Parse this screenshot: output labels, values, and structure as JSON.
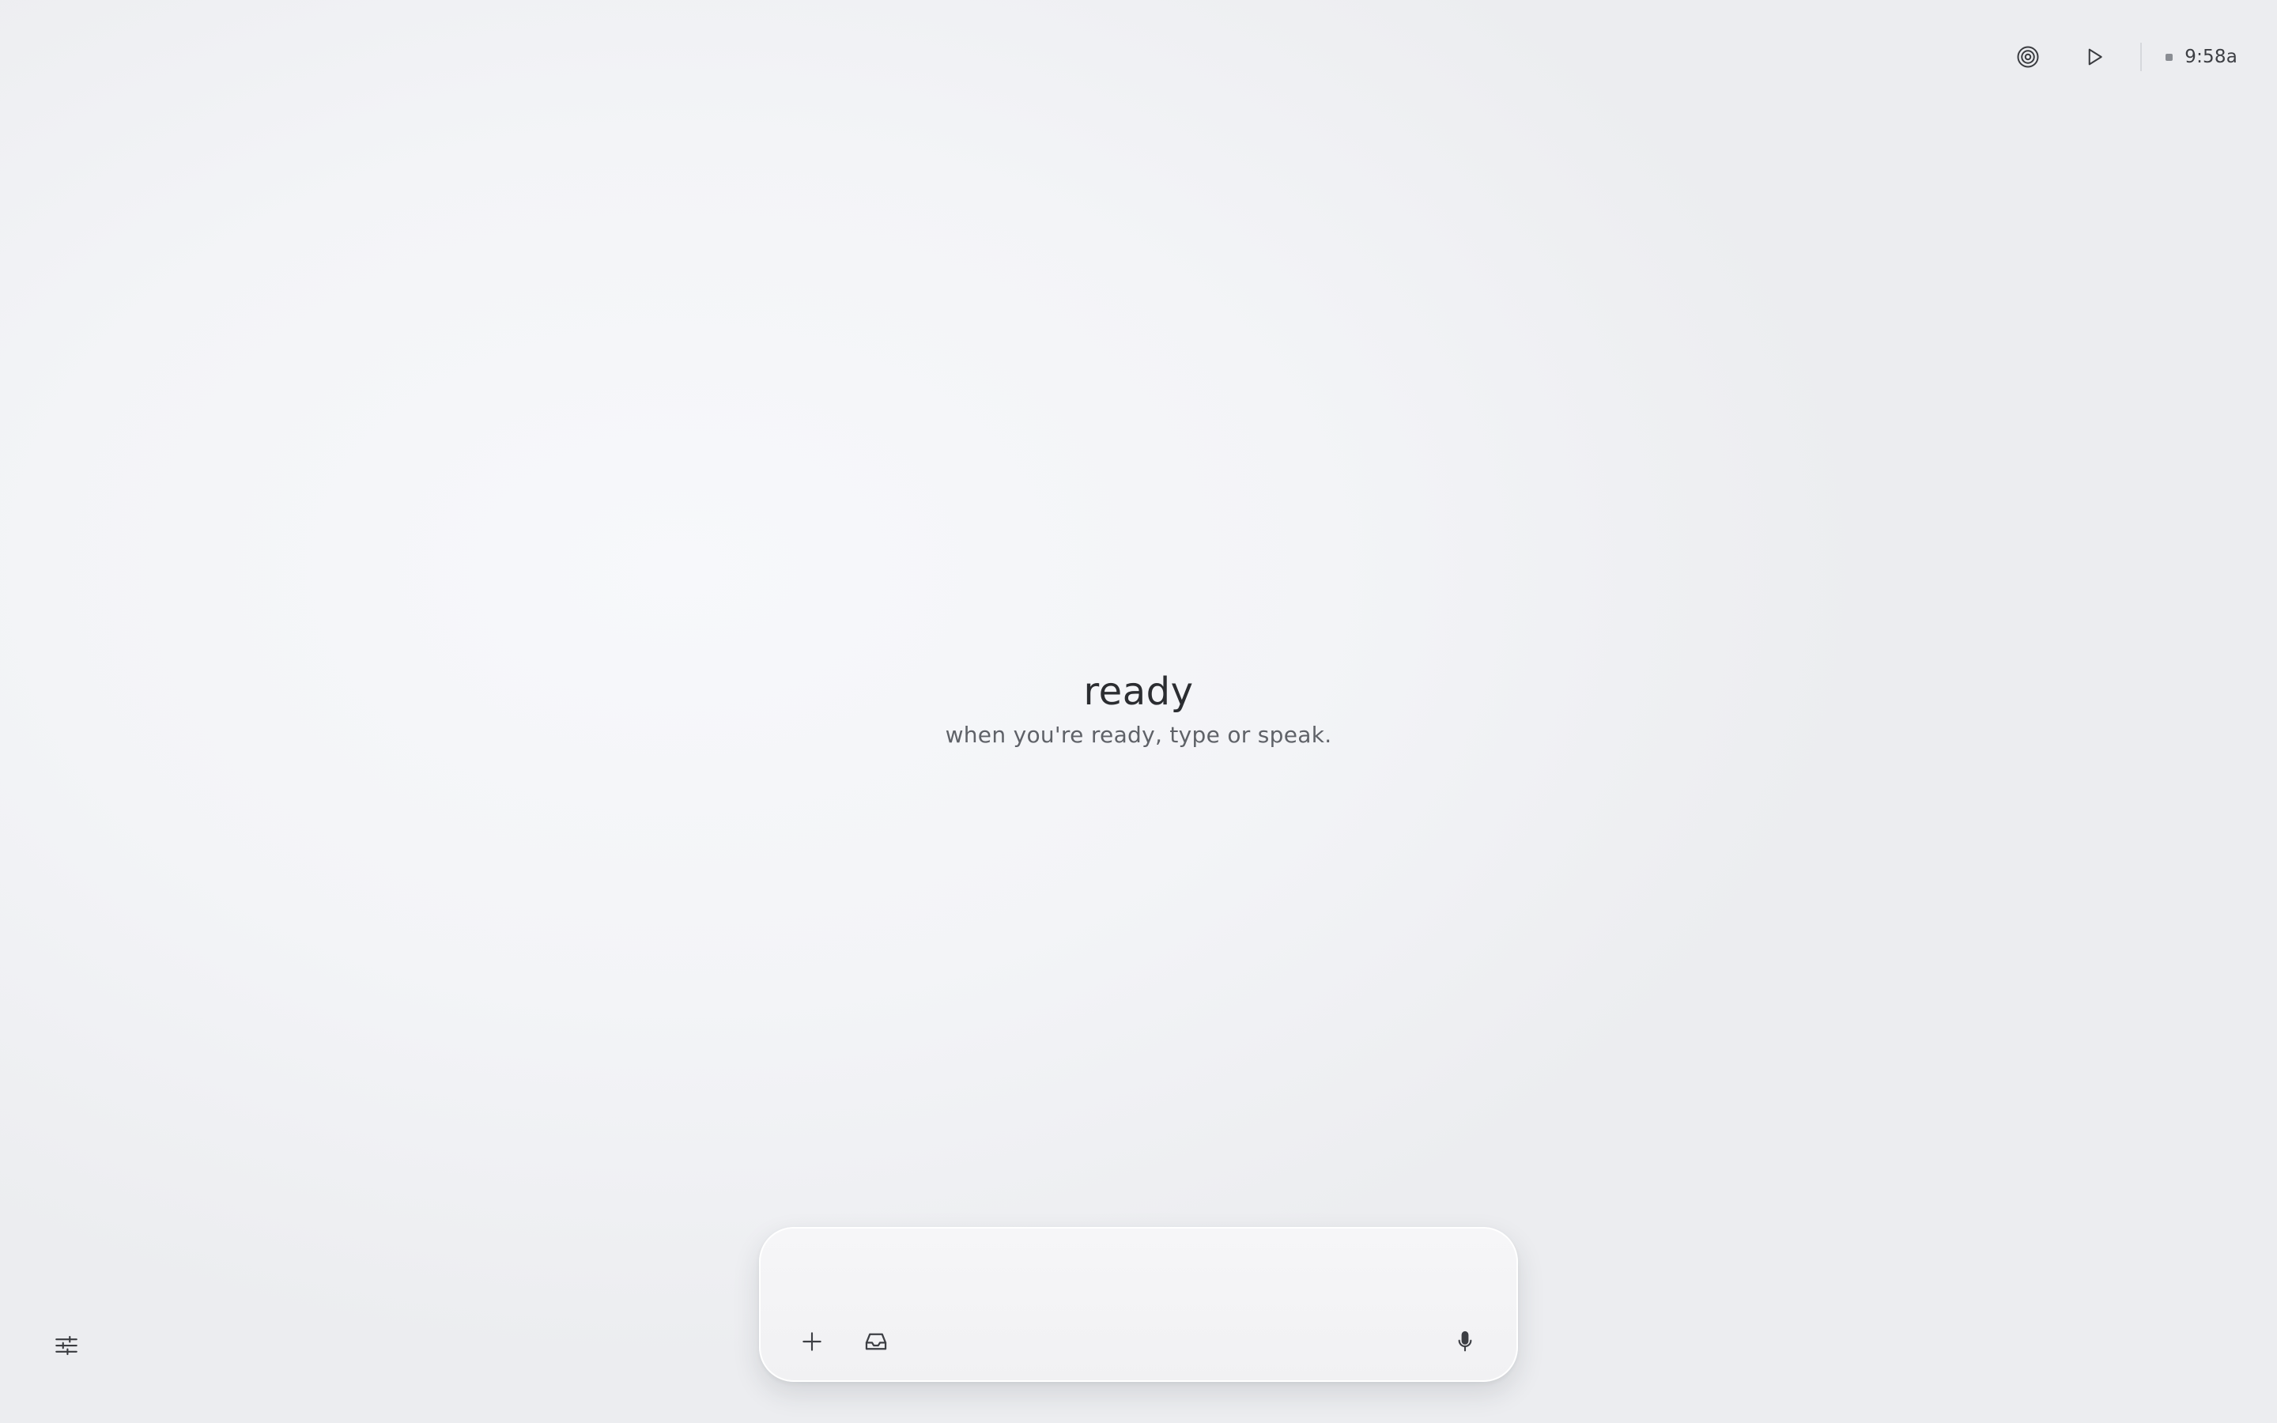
{
  "header": {
    "actions": [
      {
        "icon": "target-icon"
      },
      {
        "icon": "play-icon"
      }
    ],
    "clock": "9:58a"
  },
  "main": {
    "title": "ready",
    "subtitle": "when you're ready, type or speak."
  },
  "composer": {
    "placeholder": "",
    "tools": [
      {
        "icon": "plus-icon"
      },
      {
        "icon": "inbox-icon"
      }
    ],
    "voice_icon": "microphone-icon"
  },
  "footer": {
    "settings_icon": "sliders-icon"
  },
  "colors": {
    "background": "#f3f4f7",
    "text_primary": "#2b2d31",
    "text_secondary": "#5f6268",
    "composer_bg": "#f4f4f6"
  }
}
